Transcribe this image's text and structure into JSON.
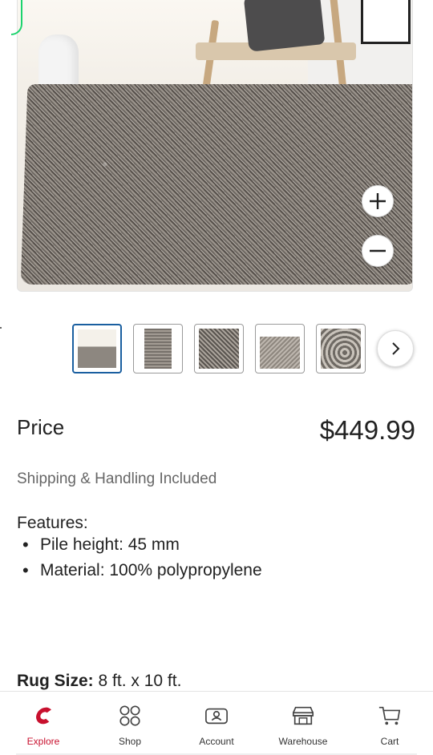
{
  "product": {
    "price_label": "Price",
    "price_value": "$449.99",
    "shipping_text": "Shipping & Handling Included",
    "features_title": "Features:",
    "features": [
      "Pile height: 45 mm",
      "Material: 100% polypropylene"
    ],
    "rug_size_label": "Rug Size:",
    "rug_size_value": "8 ft. x 10 ft."
  },
  "gallery": {
    "thumbnail_count": 5,
    "active_thumbnail": 1
  },
  "bottom_nav": {
    "items": [
      {
        "label": "Explore",
        "icon": "costco-c-icon",
        "active": true
      },
      {
        "label": "Shop",
        "icon": "grid-circles-icon",
        "active": false
      },
      {
        "label": "Account",
        "icon": "account-card-icon",
        "active": false
      },
      {
        "label": "Warehouse",
        "icon": "warehouse-icon",
        "active": false
      },
      {
        "label": "Cart",
        "icon": "cart-icon",
        "active": false
      }
    ]
  },
  "colors": {
    "accent": "#c8102e",
    "active_thumb_border": "#1a5fa0",
    "text": "#222222",
    "muted": "#666666"
  }
}
